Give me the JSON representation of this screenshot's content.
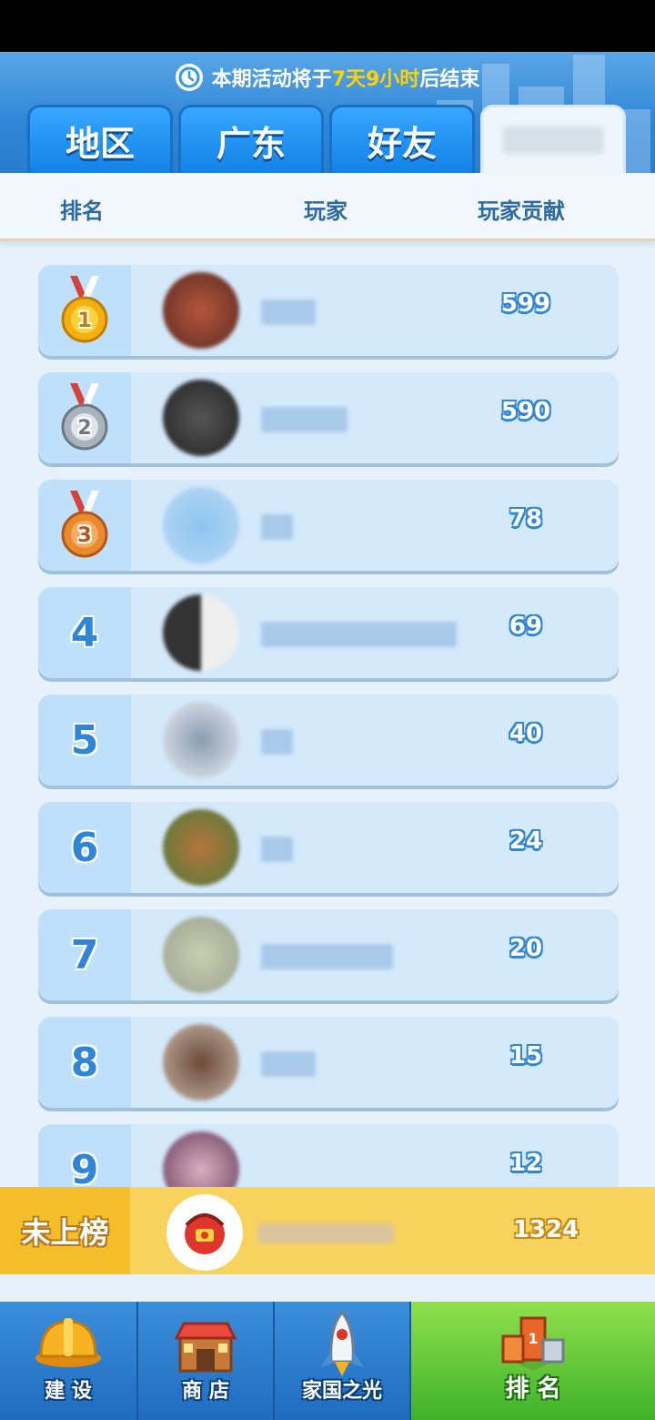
{
  "header": {
    "timer_prefix": "本期活动将于",
    "timer_highlight": "7天9小时",
    "timer_suffix": "后结束",
    "tabs": [
      {
        "label": "地区"
      },
      {
        "label": "广东"
      },
      {
        "label": "好友"
      }
    ]
  },
  "columns": {
    "rank": "排名",
    "player": "玩家",
    "contribution": "玩家贡献"
  },
  "rows": [
    {
      "rank": "1",
      "score": "599",
      "medal": "gold-medal"
    },
    {
      "rank": "2",
      "score": "590",
      "medal": "silver-medal"
    },
    {
      "rank": "3",
      "score": "78",
      "medal": "bronze-medal"
    },
    {
      "rank": "4",
      "score": "69"
    },
    {
      "rank": "5",
      "score": "40"
    },
    {
      "rank": "6",
      "score": "24"
    },
    {
      "rank": "7",
      "score": "20"
    },
    {
      "rank": "8",
      "score": "15"
    },
    {
      "rank": "9",
      "score": "12"
    }
  ],
  "my_rank": {
    "label": "未上榜",
    "score": "1324"
  },
  "bottom_nav": [
    {
      "label": "建 设",
      "icon": "helmet-icon"
    },
    {
      "label": "商 店",
      "icon": "shop-icon"
    },
    {
      "label": "家国之光",
      "icon": "rocket-icon"
    },
    {
      "label": "排 名",
      "icon": "podium-icon"
    }
  ],
  "colors": {
    "header_blue": "#2f86d6",
    "highlight_yellow": "#ffd200",
    "row_bg": "#d4e9fa",
    "my_bar": "#f7d35e",
    "nav_active_green": "#3fb22a"
  }
}
